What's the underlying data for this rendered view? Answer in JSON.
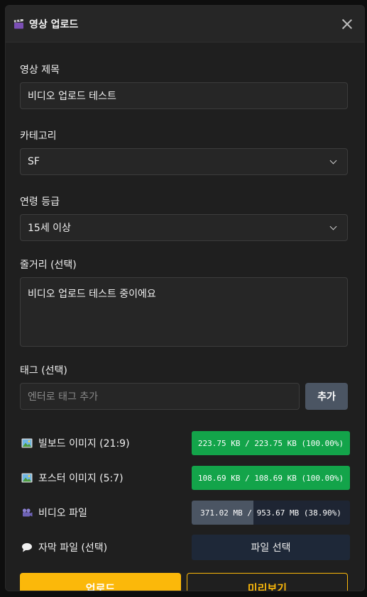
{
  "header": {
    "title": "영상 업로드",
    "icon": "clapperboard-icon"
  },
  "form": {
    "title_label": "영상 제목",
    "title_value": "비디오 업로드 테스트",
    "category_label": "카테고리",
    "category_value": "SF",
    "rating_label": "연령 등급",
    "rating_value": "15세 이상",
    "synopsis_label": "줄거리 (선택)",
    "synopsis_value": "비디오 업로드 테스트 중이에요",
    "tags_label": "태그 (선택)",
    "tags_placeholder": "엔터로 태그 추가",
    "add_tag_label": "추가"
  },
  "files": [
    {
      "label": "빌보드 이미지 (21:9)",
      "icon": "image-icon",
      "progress_text": "223.75 KB / 223.75 KB (100.00%)",
      "progress": 1.0,
      "color": "#13a44a"
    },
    {
      "label": "포스터 이미지 (5:7)",
      "icon": "image-icon",
      "progress_text": "108.69 KB / 108.69 KB (100.00%)",
      "progress": 1.0,
      "color": "#13a44a"
    },
    {
      "label": "비디오 파일",
      "icon": "camera-icon",
      "progress_text": "371.02 MB / 953.67 MB (38.90%)",
      "progress": 0.389,
      "color": "#4b5563"
    },
    {
      "label": "자막 파일 (선택)",
      "icon": "speech-bubble-icon",
      "button_label": "파일 선택"
    }
  ],
  "actions": {
    "upload_label": "업로드",
    "preview_label": "미리보기"
  },
  "colors": {
    "accent": "#fbb80a",
    "success": "#13a44a",
    "track": "#1e2533"
  }
}
